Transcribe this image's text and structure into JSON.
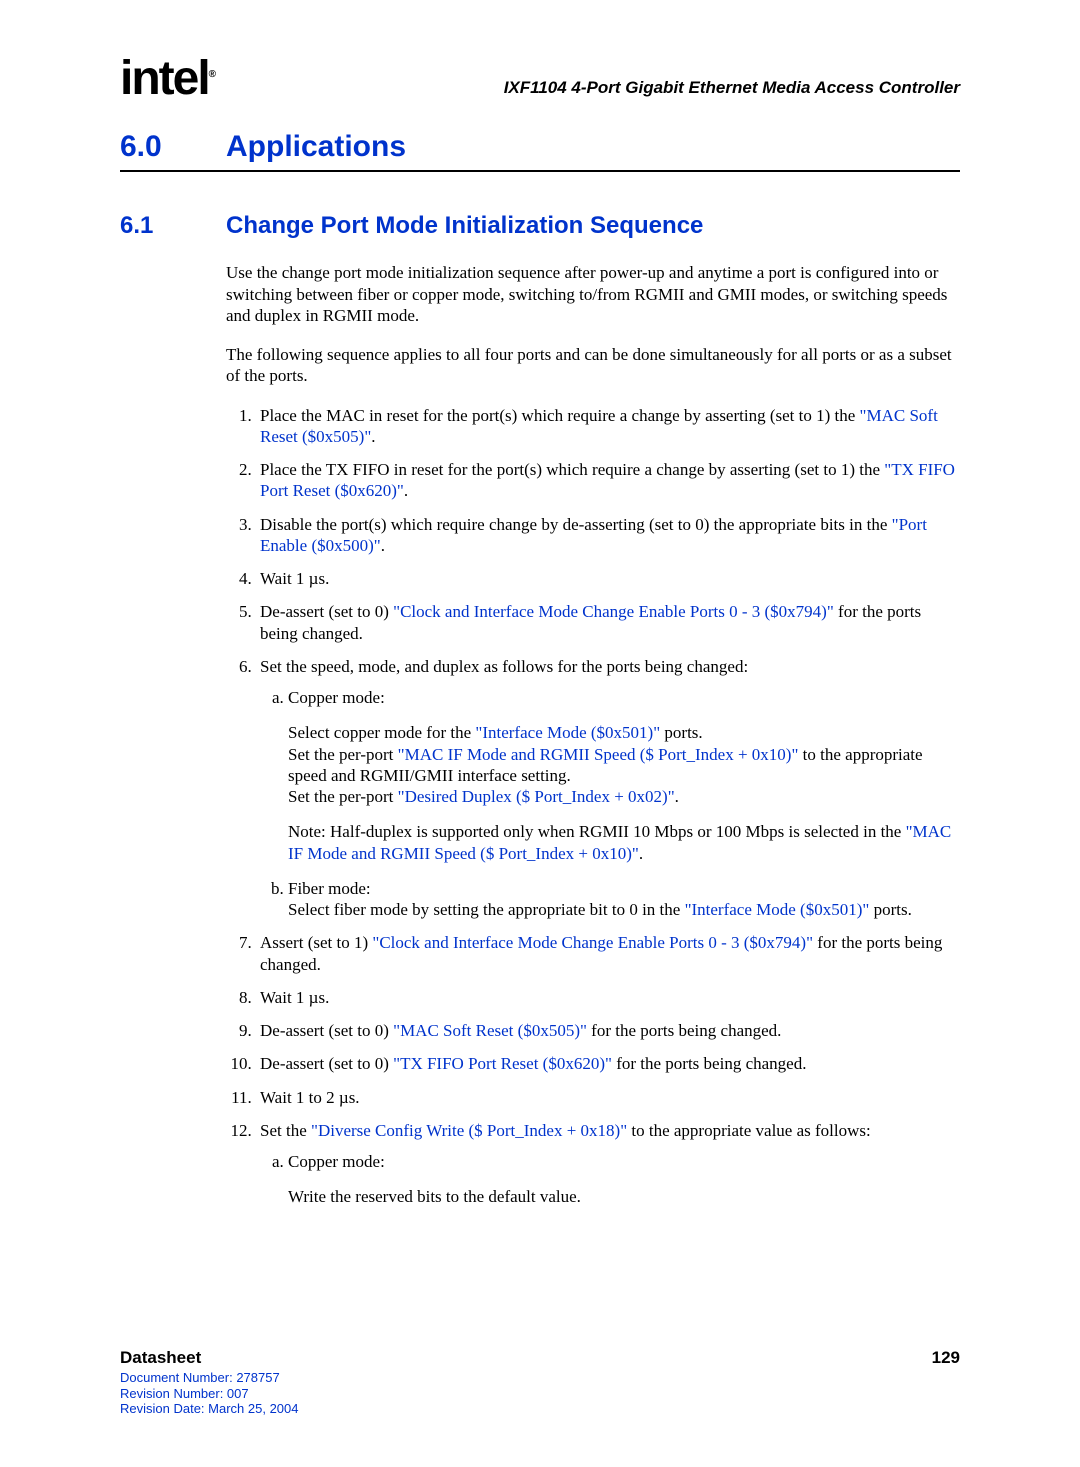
{
  "header": {
    "logo_text": "intel",
    "logo_mark": "®",
    "doc_title": "IXF1104 4-Port Gigabit Ethernet Media Access Controller"
  },
  "h1": {
    "num": "6.0",
    "text": "Applications"
  },
  "h2": {
    "num": "6.1",
    "text": "Change Port Mode Initialization Sequence"
  },
  "intro": {
    "p1": "Use the change port mode initialization sequence after power-up and anytime a port is configured into or switching between fiber or copper mode, switching to/from RGMII and GMII modes, or switching speeds and duplex in RGMII mode.",
    "p2": "The following sequence applies to all four ports and can be done simultaneously for all ports or as a subset of the ports."
  },
  "steps": {
    "s1_a": "Place the MAC in reset for the port(s) which require a change by asserting (set to 1) the ",
    "s1_link": "\"MAC Soft Reset ($0x505)\"",
    "s1_b": ".",
    "s2_a": "Place the TX FIFO in reset for the port(s) which require a change by asserting (set to 1) the ",
    "s2_link": "\"TX FIFO Port Reset ($0x620)\"",
    "s2_b": ".",
    "s3_a": "Disable the port(s) which require change by de-asserting (set to 0) the appropriate bits in the ",
    "s3_link": "\"Port Enable ($0x500)\"",
    "s3_b": ".",
    "s4": "Wait 1 µs.",
    "s5_a": "De-assert (set to 0) ",
    "s5_link": "\"Clock and Interface Mode Change Enable Ports 0 - 3 ($0x794)\"",
    "s5_b": " for the ports being changed.",
    "s6": "Set the speed, mode, and duplex as follows for the ports being changed:",
    "s6a_label": "Copper mode:",
    "s6a_p1_a": "Select copper mode for the ",
    "s6a_p1_link": "\"Interface Mode ($0x501)\"",
    "s6a_p1_b": " ports.",
    "s6a_p2_a": "Set the per-port ",
    "s6a_p2_link": "\"MAC IF Mode and RGMII Speed ($ Port_Index + 0x10)\"",
    "s6a_p2_b": " to the appropriate speed and RGMII/GMII interface setting.",
    "s6a_p3_a": "Set the per-port ",
    "s6a_p3_link": "\"Desired Duplex ($ Port_Index + 0x02)\"",
    "s6a_p3_b": ".",
    "s6a_note_a": "Note: Half-duplex is supported only when RGMII 10 Mbps or 100 Mbps is selected in the ",
    "s6a_note_link": "\"MAC IF Mode and RGMII Speed ($ Port_Index + 0x10)\"",
    "s6a_note_b": ".",
    "s6b_label": "Fiber mode:",
    "s6b_p1_a": "Select fiber mode by setting the appropriate bit to 0 in the ",
    "s6b_p1_link": "\"Interface Mode ($0x501)\"",
    "s6b_p1_b": " ports.",
    "s7_a": "Assert (set to 1) ",
    "s7_link": "\"Clock and Interface Mode Change Enable Ports 0 - 3 ($0x794)\"",
    "s7_b": " for the ports being changed.",
    "s8": "Wait 1 µs.",
    "s9_a": "De-assert (set to 0) ",
    "s9_link": "\"MAC Soft Reset ($0x505)\"",
    "s9_b": " for the ports being changed.",
    "s10_a": "De-assert (set to 0) ",
    "s10_link": "\"TX FIFO Port Reset ($0x620)\"",
    "s10_b": " for the ports being changed.",
    "s11": "Wait 1 to 2 µs.",
    "s12_a": "Set the ",
    "s12_link": "\"Diverse Config Write ($ Port_Index + 0x18)\"",
    "s12_b": " to the appropriate value as follows:",
    "s12a_label": "Copper mode:",
    "s12a_p1": "Write the reserved bits to the default value."
  },
  "footer": {
    "title": "Datasheet",
    "docnum": "Document Number: 278757",
    "revnum": "Revision Number: 007",
    "revdate": "Revision Date: March 25, 2004",
    "page": "129"
  }
}
